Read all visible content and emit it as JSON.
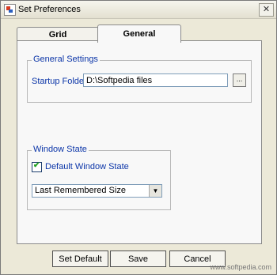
{
  "window": {
    "title": "Set Preferences",
    "close_glyph": "✕"
  },
  "tabs": [
    {
      "label": "Grid"
    },
    {
      "label": "General"
    }
  ],
  "general_settings": {
    "group_label": "General Settings",
    "startup_folder_label": "Startup Folder",
    "startup_folder_value": "D:\\Softpedia files",
    "browse_label": "...",
    "browse_icon": "ellipsis-icon"
  },
  "window_state": {
    "group_label": "Window State",
    "checkbox_label": "Default Window State",
    "checked": true,
    "select_value": "Last Remembered Size",
    "select_arrow": "▼"
  },
  "buttons": {
    "set_default": "Set Default",
    "save": "Save",
    "cancel": "Cancel"
  },
  "footer": {
    "watermark": "www.softpedia.com"
  },
  "colors": {
    "label_blue": "#0b35a8",
    "check_green": "#21a121"
  }
}
